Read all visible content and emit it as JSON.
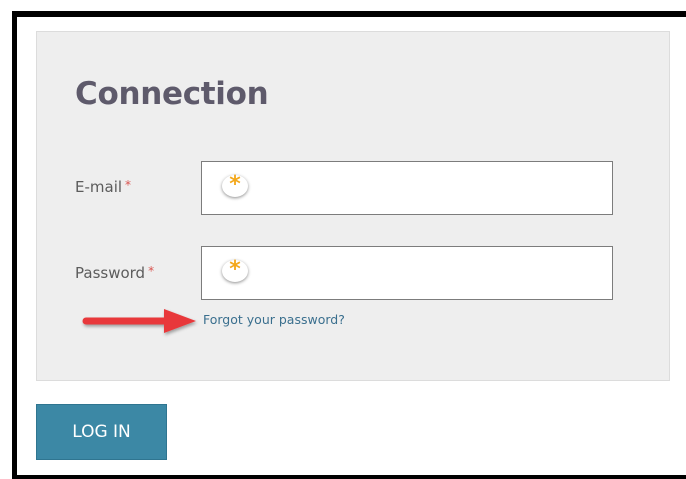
{
  "login_form": {
    "title": "Connection",
    "email": {
      "label": "E-mail",
      "required_mark": "*",
      "value": "",
      "autofill_badge": "*"
    },
    "password": {
      "label": "Password",
      "required_mark": "*",
      "value": "",
      "autofill_badge": "*"
    },
    "forgot_link": "Forgot your password?",
    "submit_label": "LOG IN"
  },
  "colors": {
    "panel_background": "#eeeeee",
    "title": "#5e5a6b",
    "required_mark": "#d9534f",
    "link": "#3a6f8e",
    "button": "#3c88a5",
    "annotation_arrow": "#e8393a",
    "badge_star": "#f3a81c"
  }
}
